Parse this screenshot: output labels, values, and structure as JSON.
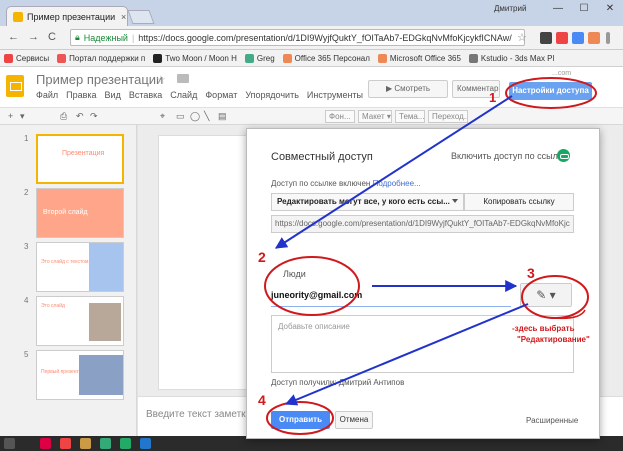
{
  "browser": {
    "tab_title": "Пример презентации -",
    "tab_close": "×",
    "user": "Дмитрий",
    "window_controls": [
      "—",
      "☐",
      "✕"
    ],
    "back": "←",
    "forward": "→",
    "reload": "C",
    "secure_label": "Надежный",
    "url": "https://docs.google.com/presentation/d/1DI9WyjfQuktY_fOITaAb7-EDGkqNvMfoKjcykfICNAw/",
    "bookmark_star": "☆"
  },
  "bookmarks": [
    {
      "label": "Сервисы",
      "color": "#e44"
    },
    {
      "label": "Портал поддержки п",
      "color": "#e55"
    },
    {
      "label": "Two Moon / Moon H",
      "color": "#222"
    },
    {
      "label": "Greg",
      "color": "#4a8"
    },
    {
      "label": "Office 365 Персонал",
      "color": "#e85"
    },
    {
      "label": "Microsoft Office 365",
      "color": "#e85"
    },
    {
      "label": "Kstudio - 3ds Max Pl",
      "color": "#777"
    }
  ],
  "app": {
    "title": "Пример презентации",
    "title_star": "☆",
    "menu": [
      "Файл",
      "Правка",
      "Вид",
      "Вставка",
      "Слайд",
      "Формат",
      "Упорядочить",
      "Инструменты",
      "Табл"
    ],
    "account": "...com",
    "present_label": "▶ Смотреть",
    "comments_label": "Комментарии",
    "share_label": "Настройки доступа"
  },
  "toolbar": {
    "icons": [
      "+",
      "▾",
      "⎙",
      "↶",
      "↷",
      "⌖",
      "▭",
      "◯",
      "╲",
      "▤"
    ],
    "background_label": "Фон...",
    "layout_label": "Макет ▾",
    "theme_label": "Тема...",
    "transition_label": "Переход..."
  },
  "slides": [
    {
      "num": "1",
      "title": "Презентация"
    },
    {
      "num": "2",
      "title": "Второй слайд"
    },
    {
      "num": "3",
      "title": "Это слайд с текстом"
    },
    {
      "num": "4",
      "title": "Это слайд"
    },
    {
      "num": "5",
      "title": "Первый презентация"
    }
  ],
  "notes_placeholder": "Введите текст заметки",
  "dialog": {
    "title": "Совместный доступ",
    "link_share": "Включить доступ по ссылке",
    "info": "Доступ по ссылке включен",
    "info_link": "Подробнее...",
    "permission": "Редактировать могут все, у кого есть ссы...",
    "copy_link": "Копировать ссылку",
    "share_url": "https://docs.google.com/presentation/d/1DI9WyjfQuktY_fOITaAb7-EDGkqNvMfoKjc",
    "people_label": "Люди",
    "email": "juneority@gmail.com",
    "pencil": "✎ ▾",
    "description_placeholder": "Добавьте описание",
    "owner": "Доступ получили: Дмитрий Антипов",
    "send": "Отправить",
    "cancel": "Отмена",
    "advanced": "Расширенные"
  },
  "annotations": {
    "steps": [
      "1",
      "2",
      "3",
      "4"
    ],
    "note_line1": "-здесь выбрать",
    "note_line2": "\"Редактирование\"",
    "color": "#d0191c",
    "arrow_color": "#2233cc"
  },
  "colors": {
    "share_button": "#6aa2f2",
    "send_button": "#4a8af4",
    "slides_brand": "#f4b400",
    "link_on": "#16a765"
  }
}
